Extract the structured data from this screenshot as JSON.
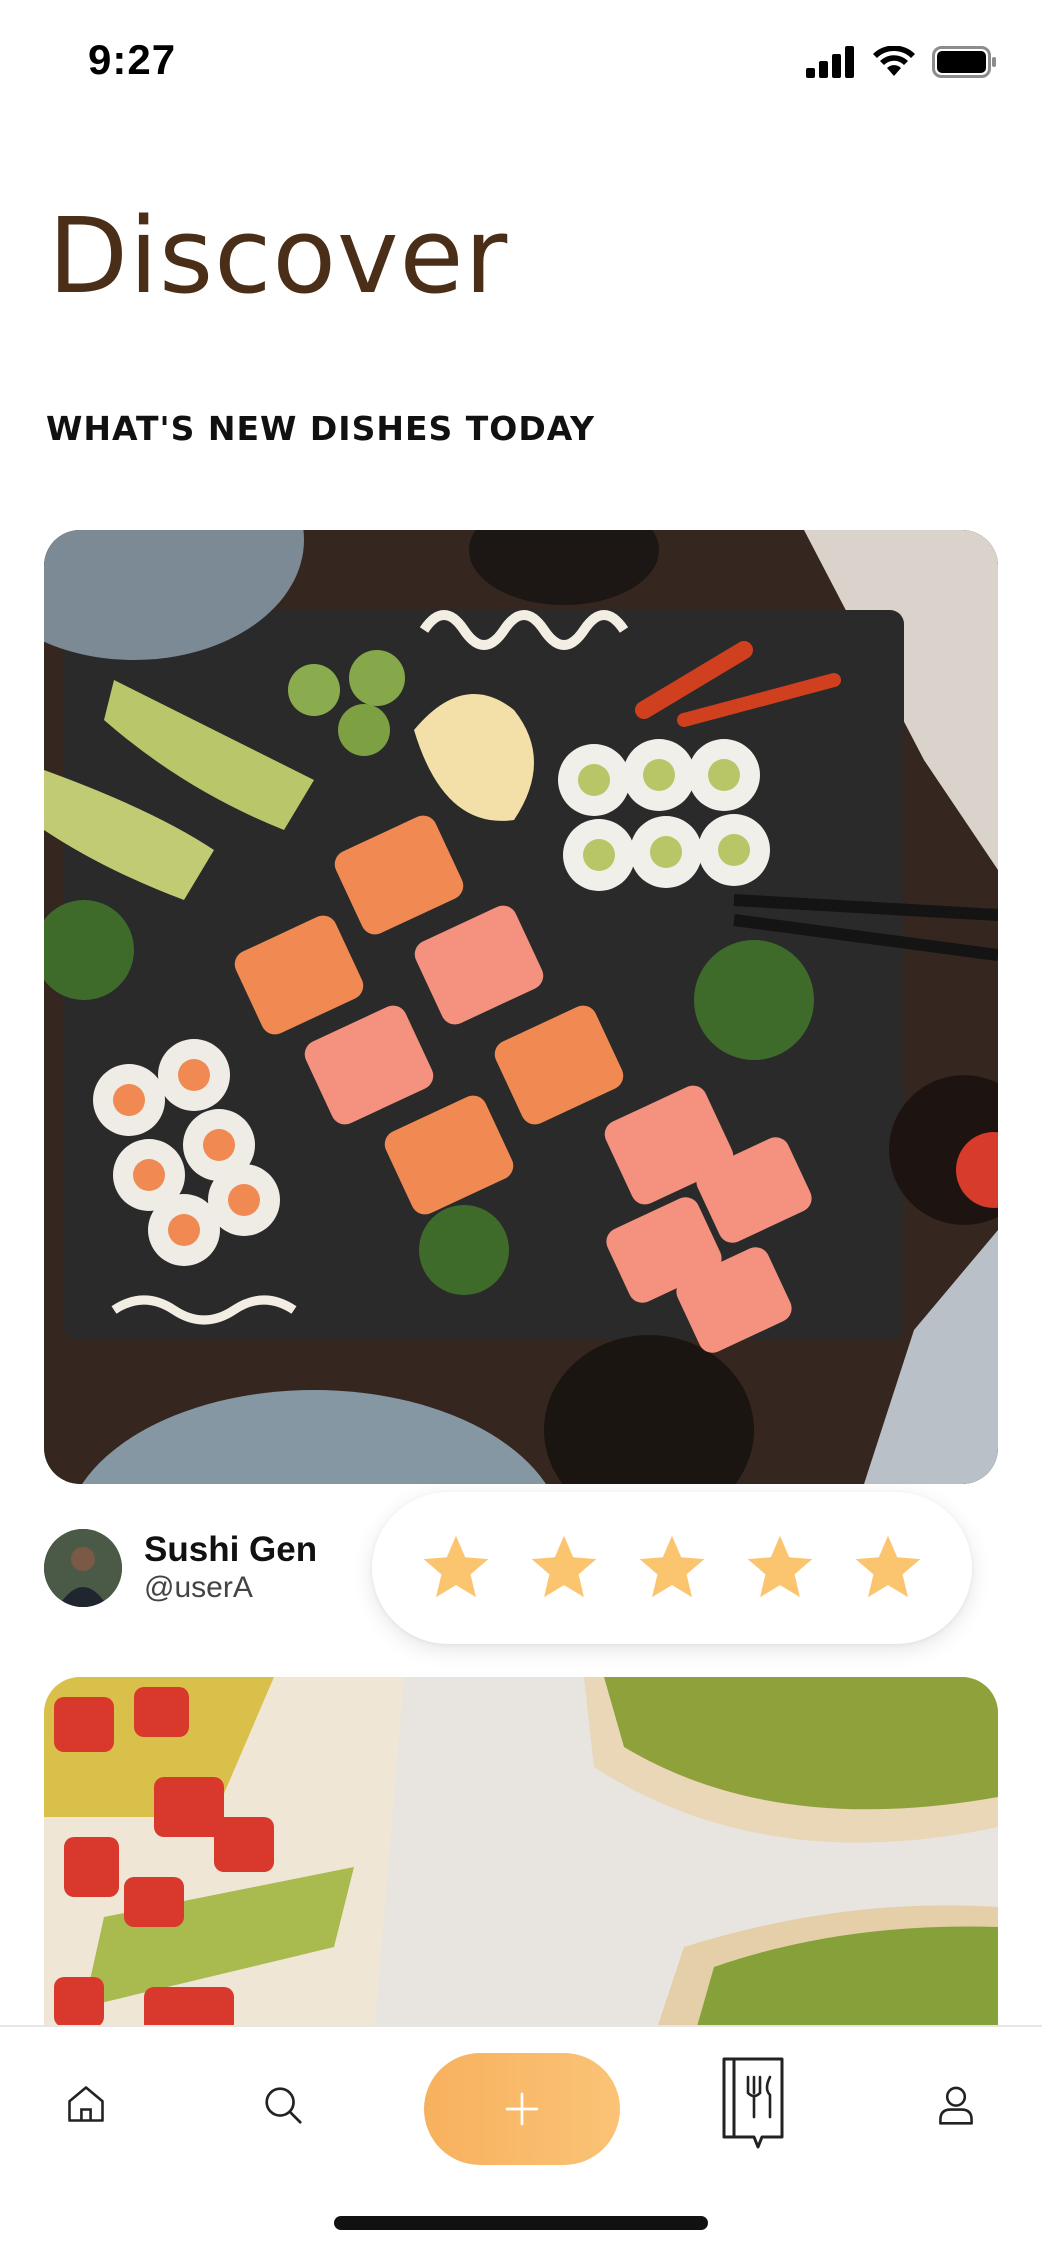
{
  "status_bar": {
    "time": "9:27"
  },
  "page": {
    "title": "Discover",
    "section_title": "WHAT'S NEW DISHES TODAY"
  },
  "feed": [
    {
      "image": "sushi-platter-photo",
      "author": {
        "name": "Sushi Gen",
        "handle": "@userA"
      },
      "rating": {
        "stars": 5,
        "max": 5
      }
    },
    {
      "image": "avocado-toast-photo"
    }
  ],
  "colors": {
    "title": "#4a2e17",
    "accent": "#f8b767",
    "star": "#fbc46e"
  },
  "tab_bar": {
    "items": [
      "home-icon",
      "search-icon",
      "plus-icon",
      "recipe-book-icon",
      "profile-icon"
    ]
  }
}
